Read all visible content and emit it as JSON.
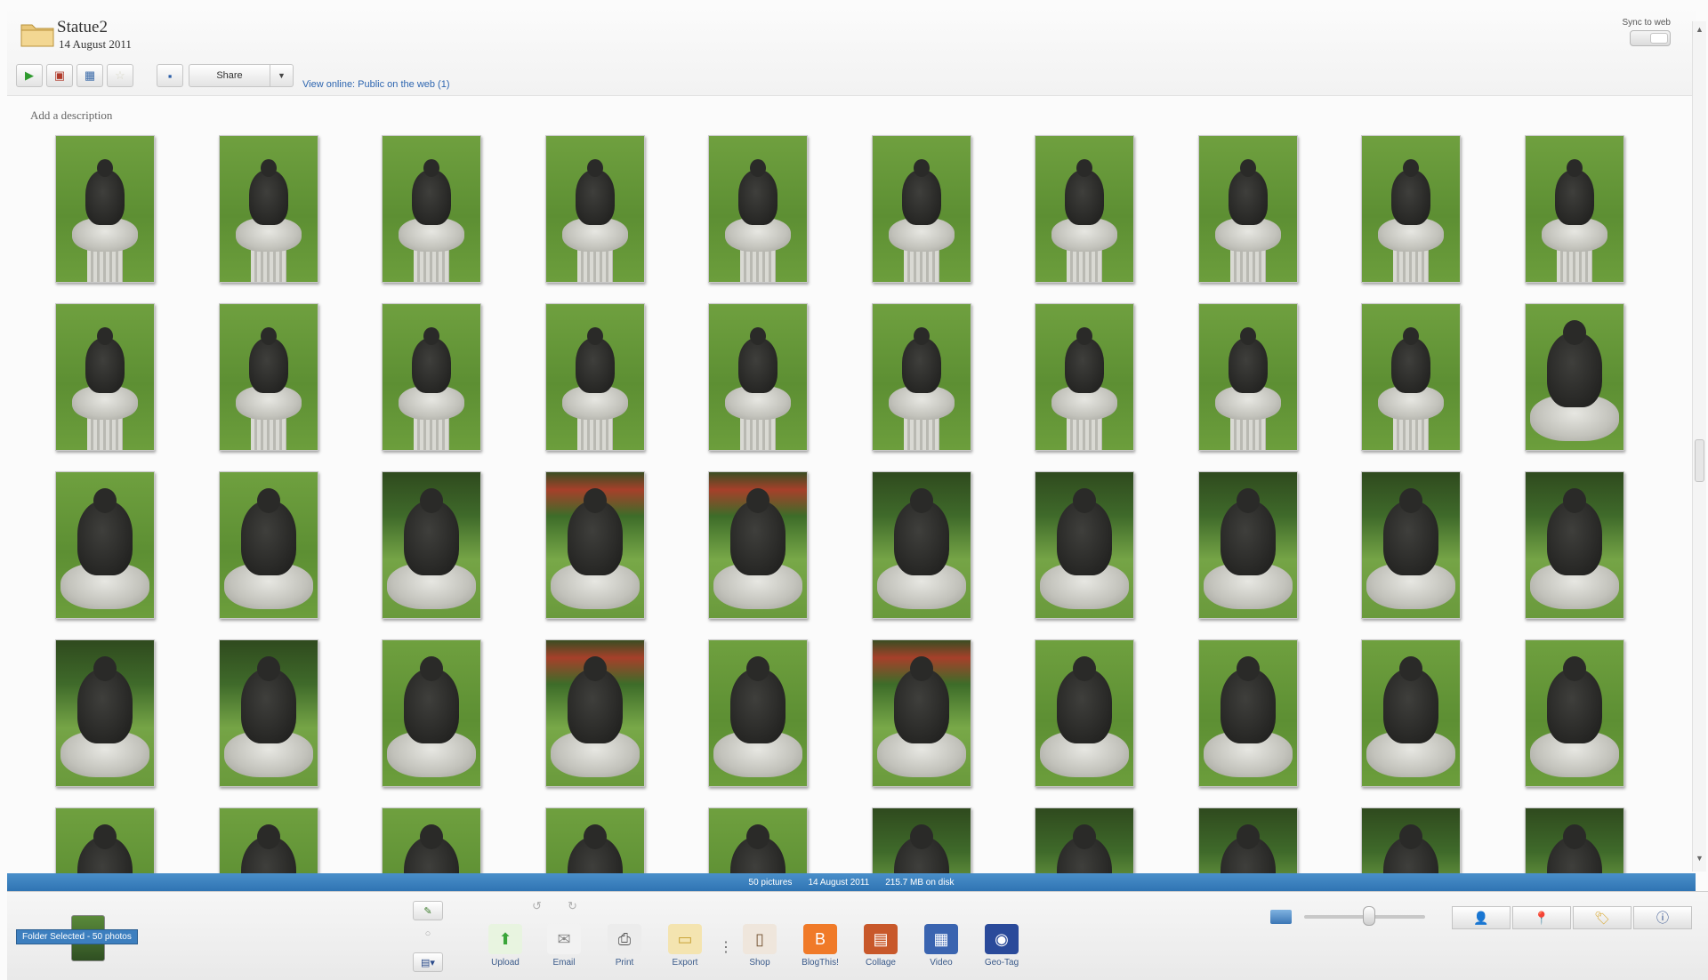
{
  "header": {
    "title": "Statue2",
    "date": "14 August 2011",
    "sync_label": "Sync to web",
    "share_label": "Share",
    "view_online": "View online: Public on the web (1)",
    "description_placeholder": "Add a description"
  },
  "toolbar": {
    "buttons": [
      {
        "name": "play-slideshow-icon",
        "glyph": "▶",
        "color": "#2e9a2e"
      },
      {
        "name": "gift-cd-icon",
        "glyph": "▣",
        "color": "#b03a2a"
      },
      {
        "name": "movie-icon",
        "glyph": "▦",
        "color": "#3a6aa8"
      },
      {
        "name": "star-icon",
        "glyph": "☆",
        "color": "#d8d8c8"
      },
      {
        "name": "save-icon",
        "glyph": "▪",
        "color": "#2a5da8"
      }
    ]
  },
  "grid": {
    "rows": [
      [
        "statue",
        "statue",
        "statue",
        "statue",
        "statue",
        "statue",
        "statue",
        "statue",
        "statue",
        "statue"
      ],
      [
        "statue",
        "statue",
        "statue",
        "statue",
        "statue",
        "statue",
        "statue",
        "statue",
        "statue",
        "close"
      ],
      [
        "close",
        "close",
        "close-garden",
        "close-flowers",
        "close-flowers",
        "close-garden",
        "close-garden",
        "close-garden",
        "close-garden",
        "close-garden"
      ],
      [
        "close-garden",
        "close-garden",
        "close",
        "close-flowers",
        "close",
        "close-flowers",
        "close",
        "close",
        "close",
        "close"
      ],
      [
        "close",
        "close",
        "close",
        "close",
        "close",
        "close-garden",
        "close-garden",
        "close-garden",
        "close-garden",
        "close-garden"
      ]
    ]
  },
  "status": {
    "count": "50 pictures",
    "date": "14 August 2011",
    "size": "215.7 MB on disk"
  },
  "tray": {
    "selection_label": "Folder Selected - 50 photos",
    "tools": [
      {
        "label": "Upload",
        "name": "upload-icon",
        "glyph": "⬆",
        "color": "#3aa53a",
        "bg": "#e8f4e0"
      },
      {
        "label": "Email",
        "name": "email-icon",
        "glyph": "✉",
        "color": "#888888",
        "bg": "#f2f2f2"
      },
      {
        "label": "Print",
        "name": "print-icon",
        "glyph": "⎙",
        "color": "#555555",
        "bg": "#ececec"
      },
      {
        "label": "Export",
        "name": "export-folder-icon",
        "glyph": "▭",
        "color": "#c9a43a",
        "bg": "#f4e4b0"
      },
      {
        "label": "Shop",
        "name": "shop-icon",
        "glyph": "▯",
        "color": "#7a5a3a",
        "bg": "#efe6dc"
      },
      {
        "label": "BlogThis!",
        "name": "blogger-icon",
        "glyph": "B",
        "color": "#ffffff",
        "bg": "#f07a28"
      },
      {
        "label": "Collage",
        "name": "collage-icon",
        "glyph": "▤",
        "color": "#ffffff",
        "bg": "#c8582a"
      },
      {
        "label": "Video",
        "name": "video-icon",
        "glyph": "▦",
        "color": "#ffffff",
        "bg": "#3a64b0"
      },
      {
        "label": "Geo-Tag",
        "name": "geotag-globe-icon",
        "glyph": "◉",
        "color": "#ffffff",
        "bg": "#2a4a9a"
      }
    ],
    "right_buttons": [
      {
        "name": "people-icon",
        "glyph": "👤",
        "color": "#2a4a8a"
      },
      {
        "name": "places-pin-icon",
        "glyph": "📍",
        "color": "#c82a2a"
      },
      {
        "name": "tags-icon",
        "glyph": "🏷",
        "color": "#d8a830"
      },
      {
        "name": "info-icon",
        "glyph": "ⓘ",
        "color": "#2a4a8a"
      }
    ]
  }
}
